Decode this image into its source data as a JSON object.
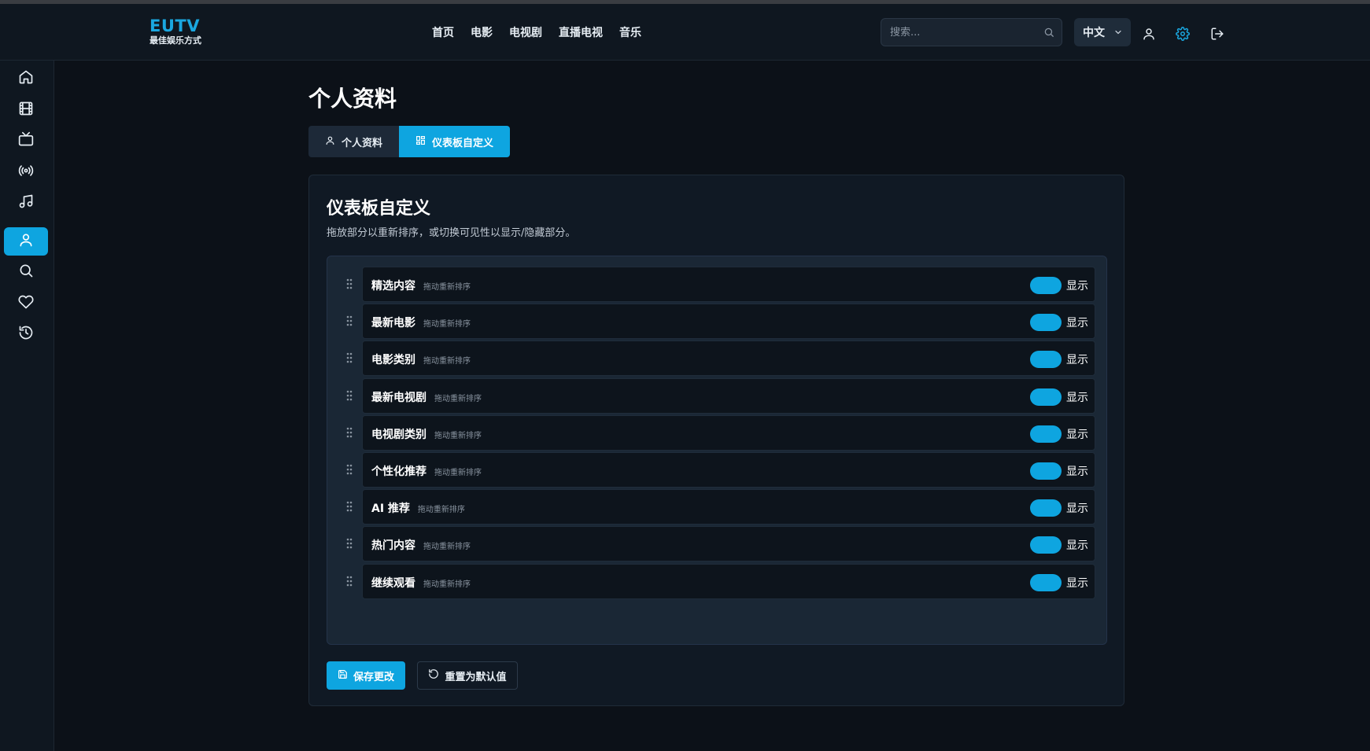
{
  "brand": {
    "name": "EUTV",
    "tagline": "最佳娱乐方式"
  },
  "nav": {
    "items": [
      "首页",
      "电影",
      "电视剧",
      "直播电视",
      "音乐"
    ]
  },
  "search": {
    "placeholder": "搜索..."
  },
  "language": {
    "selected": "中文"
  },
  "header_icons": [
    "user-icon",
    "settings-icon",
    "logout-icon"
  ],
  "sidebar": {
    "items": [
      "home-icon",
      "film-icon",
      "tv-icon",
      "broadcast-icon",
      "music-icon",
      "user-icon",
      "search-icon",
      "heart-icon",
      "history-icon"
    ],
    "active": "user-icon"
  },
  "page": {
    "title": "个人资料"
  },
  "tabs": [
    {
      "label": "个人资料",
      "icon": "user-icon"
    },
    {
      "label": "仪表板自定义",
      "icon": "dashboard-icon",
      "active": true
    }
  ],
  "card": {
    "title": "仪表板自定义",
    "description": "拖放部分以重新排序，或切换可见性以显示/隐藏部分。"
  },
  "sections": [
    {
      "label": "精选内容",
      "hint": "拖动重新排序",
      "toggle": "显示"
    },
    {
      "label": "最新电影",
      "hint": "拖动重新排序",
      "toggle": "显示"
    },
    {
      "label": "电影类别",
      "hint": "拖动重新排序",
      "toggle": "显示"
    },
    {
      "label": "最新电视剧",
      "hint": "拖动重新排序",
      "toggle": "显示"
    },
    {
      "label": "电视剧类别",
      "hint": "拖动重新排序",
      "toggle": "显示"
    },
    {
      "label": "个性化推荐",
      "hint": "拖动重新排序",
      "toggle": "显示"
    },
    {
      "label": "AI 推荐",
      "hint": "拖动重新排序",
      "toggle": "显示"
    },
    {
      "label": "热门内容",
      "hint": "拖动重新排序",
      "toggle": "显示"
    },
    {
      "label": "继续观看",
      "hint": "拖动重新排序",
      "toggle": "显示"
    }
  ],
  "buttons": {
    "save": "保存更改",
    "reset": "重置为默认值"
  },
  "colors": {
    "accent": "#0ea5e0",
    "brand": "#1aa7e0",
    "background": "#0c1118"
  }
}
